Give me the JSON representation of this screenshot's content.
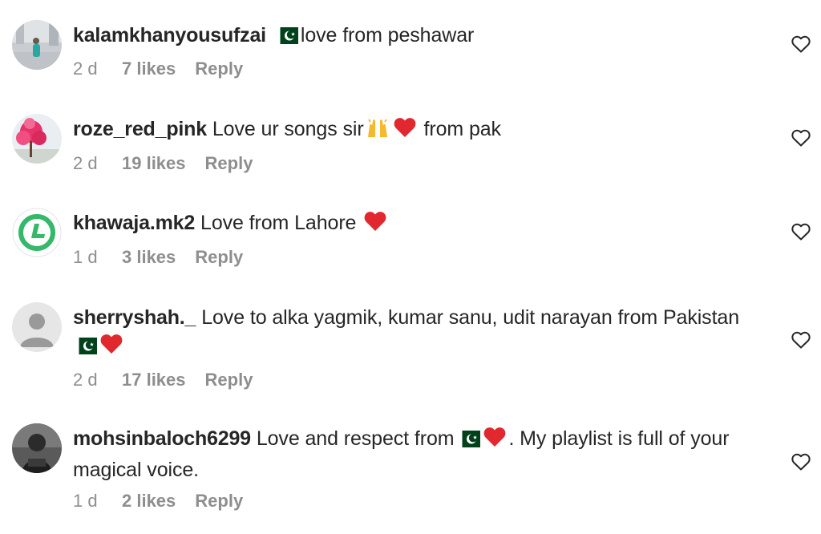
{
  "comments": [
    {
      "username": "kalamkhanyousufzai",
      "pre_text": "",
      "post_text": "love from peshawar",
      "time": "2 d",
      "likes": "7 likes",
      "reply": "Reply",
      "avatar": "photo-person-icon"
    },
    {
      "username": "roze_red_pink",
      "pre_text": "Love ur songs sir",
      "post_text": "from pak",
      "time": "2 d",
      "likes": "19 likes",
      "reply": "Reply",
      "avatar": "pink-tree-photo-icon"
    },
    {
      "username": "khawaja.mk2",
      "pre_text": "Love from Lahore",
      "post_text": "",
      "time": "1 d",
      "likes": "3 likes",
      "reply": "Reply",
      "avatar": "green-l-logo-icon"
    },
    {
      "username": "sherryshah._",
      "pre_text": "Love to alka yagmik, kumar sanu, udit narayan from Pakistan",
      "post_text": "",
      "time": "2 d",
      "likes": "17 likes",
      "reply": "Reply",
      "avatar": "default-user-icon"
    },
    {
      "username": "mohsinbaloch6299",
      "pre_text": "Love and respect from",
      "post_text": ". My playlist is full of your magical voice.",
      "time": "1 d",
      "likes": "2 likes",
      "reply": "Reply",
      "avatar": "dark-photo-person-icon"
    }
  ],
  "icons": {
    "like": "heart-outline-icon",
    "flag": "pakistan-flag-icon",
    "heart": "red-heart-icon",
    "hands": "raised-hands-icon"
  },
  "colors": {
    "text": "#262626",
    "secondary": "#8e8e8e",
    "heart": "#e0282e",
    "flag_green": "#01411c"
  }
}
